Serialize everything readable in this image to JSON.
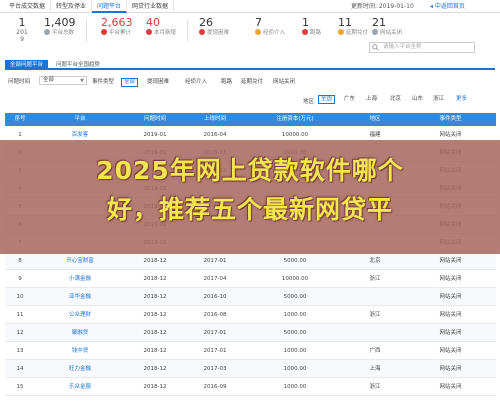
{
  "top_tabs": [
    "平台成交数据",
    "转型及停业",
    "问题平台",
    "网贷行业数据"
  ],
  "active_tab_index": 2,
  "update_time": "更新时间: 2019-01-10",
  "back_link": "◂ 中返回首页",
  "date": {
    "day": "1",
    "year": "201",
    "year2": "9"
  },
  "stats": [
    {
      "num": "1,409",
      "label": "平台总数",
      "red": false
    },
    {
      "num": "2,663",
      "label": "平台累计",
      "red": true
    },
    {
      "num": "40",
      "label": "本月新增",
      "red": true
    },
    {
      "num": "26",
      "label": "提现困难",
      "red": false
    },
    {
      "num": "7",
      "label": "经侦介入",
      "red": false
    },
    {
      "num": "1",
      "label": "跑路",
      "red": false
    },
    {
      "num": "11",
      "label": "延期兑付",
      "red": false
    },
    {
      "num": "21",
      "label": "网站关闭",
      "red": false
    }
  ],
  "search_placeholder": "请输入平台全称",
  "sub_tabs": [
    "全部问题平台",
    "问题平台全国趋势"
  ],
  "filters": {
    "time_label": "问题时间",
    "time_value": "全部",
    "type_label": "事件类型",
    "type_options": [
      "全部",
      "提现困难",
      "经侦介入",
      "跑路",
      "延期兑付",
      "网站关闭"
    ],
    "region_label": "地区",
    "region_options": [
      "全国",
      "广东",
      "上海",
      "北京",
      "山东",
      "浙江"
    ],
    "more": "更多"
  },
  "table": {
    "headers": [
      "序号",
      "平台",
      "问题时间",
      "上线时间",
      "注册资本(万元)",
      "地区",
      "事件类型"
    ],
    "rows": [
      [
        "1",
        "百发客",
        "2019-01",
        "2016-04",
        "10000.00",
        "福建",
        "网站关闭"
      ],
      [
        "2",
        "",
        "2019-01",
        "2015-11",
        "1000.00",
        "",
        "网站关闭"
      ],
      [
        "3",
        "",
        "2019-01",
        "2015-12",
        "5000.00",
        "",
        "网站关闭"
      ],
      [
        "4",
        "",
        "2019-01",
        "",
        "",
        "",
        "网站关闭"
      ],
      [
        "5",
        "",
        "2019-01",
        "",
        "",
        "",
        "网站关闭"
      ],
      [
        "6",
        "",
        "2019-01",
        "",
        "",
        "",
        "网站关闭"
      ],
      [
        "7",
        "",
        "2019-01",
        "",
        "",
        "",
        "网站关闭"
      ],
      [
        "8",
        "开心宝财富",
        "2018-12",
        "2017-01",
        "5000.00",
        "北京",
        "网站关闭"
      ],
      [
        "9",
        "小满金融",
        "2018-12",
        "2017-04",
        "10000.00",
        "浙江",
        "网站关闭"
      ],
      [
        "10",
        "亚华金融",
        "2018-12",
        "2016-10",
        "5000.00",
        "",
        "网站关闭"
      ],
      [
        "11",
        "公众理财",
        "2018-12",
        "2016-08",
        "1000.00",
        "浙江",
        "网站关闭"
      ],
      [
        "12",
        "聚融贷",
        "2018-12",
        "2017-01",
        "5000.00",
        "",
        "网站关闭"
      ],
      [
        "13",
        "钱中贷",
        "2018-12",
        "2017-01",
        "1000.00",
        "广西",
        "网站关闭"
      ],
      [
        "14",
        "旺力金融",
        "2018-12",
        "2017-03",
        "1000.00",
        "上海",
        "网站关闭"
      ],
      [
        "15",
        "乐众金服",
        "2018-12",
        "2016-09",
        "1000.00",
        "浙江",
        "网站关闭"
      ]
    ]
  },
  "overlay": {
    "line1": "2025年网上贷款软件哪个",
    "line2": "好，推荐五个最新网贷平"
  },
  "colors": {
    "accent": "#1a73d9",
    "header_bg": "#2f8adf",
    "red": "#e23b3b",
    "banner_bg": "#a86960",
    "banner_text": "#f3e54d"
  }
}
